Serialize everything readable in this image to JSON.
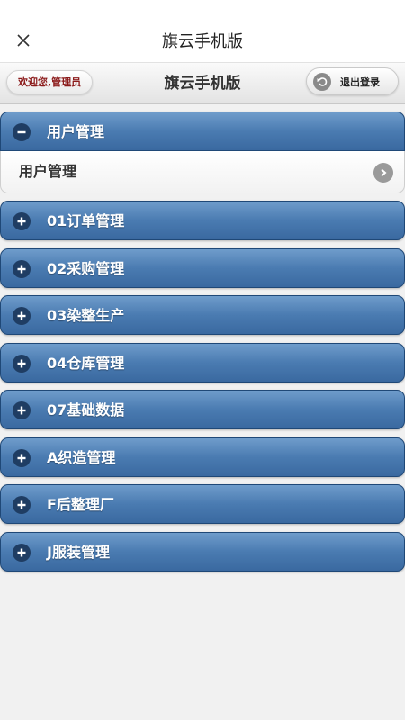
{
  "window": {
    "title": "旗云手机版",
    "close_icon": "close-icon"
  },
  "header": {
    "welcome": "欢迎您,管理员",
    "title": "旗云手机版",
    "logout_label": "退出登录",
    "logout_icon": "undo-arrow-icon"
  },
  "menu": {
    "open_section": {
      "label": "用户管理",
      "icon": "minus-circle-icon",
      "items": [
        {
          "label": "用户管理",
          "icon": "chevron-right-icon"
        }
      ]
    },
    "sections": [
      {
        "label": "01订单管理",
        "icon": "plus-circle-icon"
      },
      {
        "label": "02采购管理",
        "icon": "plus-circle-icon"
      },
      {
        "label": "03染整生产",
        "icon": "plus-circle-icon"
      },
      {
        "label": "04仓库管理",
        "icon": "plus-circle-icon"
      },
      {
        "label": "07基础数据",
        "icon": "plus-circle-icon"
      },
      {
        "label": "A织造管理",
        "icon": "plus-circle-icon"
      },
      {
        "label": "F后整理厂",
        "icon": "plus-circle-icon"
      },
      {
        "label": "J服装管理",
        "icon": "plus-circle-icon"
      }
    ]
  },
  "colors": {
    "section_top": "#6f9ccb",
    "section_bottom": "#3a69a0",
    "welcome_text": "#8b1a1a",
    "page_bg": "#f1f1f1"
  }
}
